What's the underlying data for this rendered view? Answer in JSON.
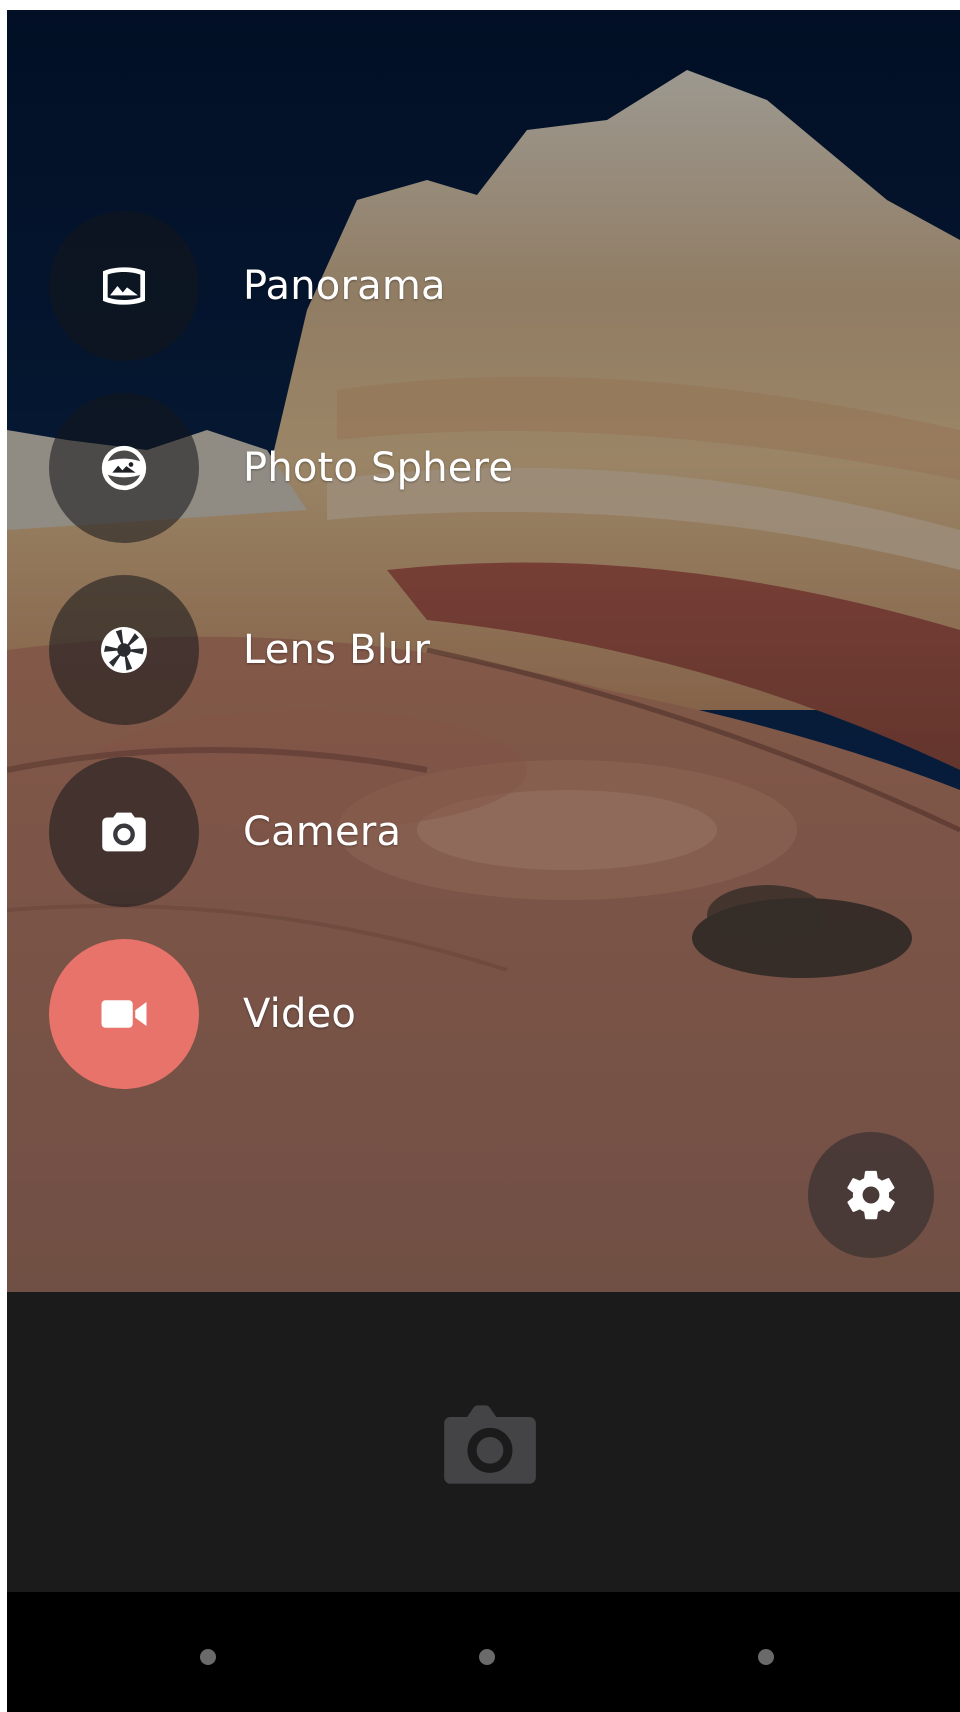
{
  "modes": [
    {
      "label": "Panorama",
      "icon": "panorama-icon",
      "active": false
    },
    {
      "label": "Photo Sphere",
      "icon": "photo-sphere-icon",
      "active": false
    },
    {
      "label": "Lens Blur",
      "icon": "lens-blur-icon",
      "active": false
    },
    {
      "label": "Camera",
      "icon": "camera-icon",
      "active": false
    },
    {
      "label": "Video",
      "icon": "videocam-icon",
      "active": true
    }
  ],
  "settings": {
    "icon": "gear-icon"
  },
  "shutter": {
    "icon": "camera-icon"
  },
  "nav": {
    "icons": [
      "nav-dot",
      "nav-dot",
      "nav-dot"
    ]
  },
  "colors": {
    "active_mode": "#e8736b",
    "mode_circle": "#1e2024",
    "bottom_panel": "#1b1b1b",
    "label_text": "#ffffff"
  }
}
